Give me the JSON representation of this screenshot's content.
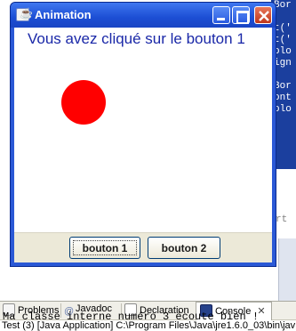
{
  "editor": {
    "lines": [
      "Bor",
      "",
      "t('",
      "t('",
      "olo",
      "ign",
      "",
      "Bor",
      "ont",
      "olo"
    ],
    "word": "rt"
  },
  "window": {
    "title": "Animation",
    "message": "Vous avez cliqué sur le bouton 1",
    "ball_color": "#ff0000",
    "buttons": {
      "b1": "bouton 1",
      "b2": "bouton 2"
    }
  },
  "views": {
    "tabs": {
      "problems": "Problems",
      "javadoc": "Javadoc",
      "declaration": "Declaration",
      "console": "Console"
    },
    "console_title": "Test (3) [Java Application] C:\\Program Files\\Java\\jre1.6.0_03\\bin\\jav",
    "console_output": "Ma classe interne numéro 3 écoute bien !"
  }
}
